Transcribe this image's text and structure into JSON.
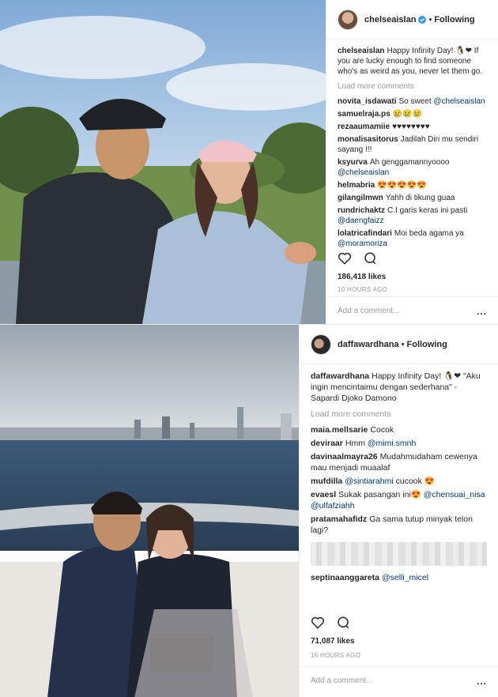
{
  "post1": {
    "username": "chelseaislan",
    "follow_label": "Following",
    "caption_user": "chelseaislan",
    "caption_text": "Happy Infinity Day! 🐧❤ If you are lucky enough to find someone who's as weird as you, never let them go.",
    "load_more": "Load more comments",
    "comments": [
      {
        "user": "novita_isdawati",
        "text": "So sweet ",
        "mention": "@chelseaislan"
      },
      {
        "user": "samuelraja.ps",
        "text": "😢😢😢",
        "mention": ""
      },
      {
        "user": "rezaaumamiie",
        "text": "♥♥♥♥♥♥♥♥",
        "mention": ""
      },
      {
        "user": "monalisasitorus",
        "text": "Jadilah Diri mu sendiri sayang !!!",
        "mention": ""
      },
      {
        "user": "ksyurva",
        "text": "Ah genggamannyoooo ",
        "mention": "@chelseaislan"
      },
      {
        "user": "helmabria",
        "text": "😍😍😍😍😍",
        "mention": ""
      },
      {
        "user": "gilangilmwn",
        "text": "Yahh di tikung guaa",
        "mention": ""
      },
      {
        "user": "rundrichaktz",
        "text": "C.I garis keras ini pasti ",
        "mention": "@daengfaizz"
      },
      {
        "user": "lolatricafindari",
        "text": "Moi beda agama ya ",
        "mention": "@moramoriza"
      }
    ],
    "likes": "186,418 likes",
    "time": "10 HOURS AGO",
    "add_comment": "Add a comment...",
    "more": "..."
  },
  "post2": {
    "username": "daffawardhana",
    "follow_label": "Following",
    "caption_user": "daffawardhana",
    "caption_text": "Happy Infinity Day! 🐧❤ \"Aku ingin mencintaimu dengan sederhana\" - Sapardi Djoko Damono",
    "load_more": "Load more comments",
    "comments": [
      {
        "user": "maia.mellsarie",
        "text": "Cocok",
        "mention": "",
        "after": ""
      },
      {
        "user": "deviraar",
        "text": "Hmm ",
        "mention": "@mimi.smnh",
        "after": ""
      },
      {
        "user": "davinaalmayra26",
        "text": "Mudahmudaham cewenya mau menjadi muaalaf",
        "mention": "",
        "after": ""
      },
      {
        "user": "mufdilla",
        "text": "",
        "mention": "@sintiarahmi",
        "after": " cucook 😍"
      },
      {
        "user": "evaesl",
        "text": "Sukak pasangan ini😍 ",
        "mention": "@chensuai_nisa @ulfafziahh",
        "after": ""
      },
      {
        "user": "pratamahafidz",
        "text": "Ga sama tutup minyak telon lagi?",
        "mention": "",
        "after": ""
      }
    ],
    "last_comment": {
      "user": "septinaanggareta",
      "mention": "@selli_micel"
    },
    "likes": "71,087 likes",
    "time": "16 HOURS AGO",
    "add_comment": "Add a comment...",
    "more": "..."
  },
  "colors": {
    "accent": "#3897f0",
    "mention": "#003569",
    "heart": "#ed4956"
  }
}
